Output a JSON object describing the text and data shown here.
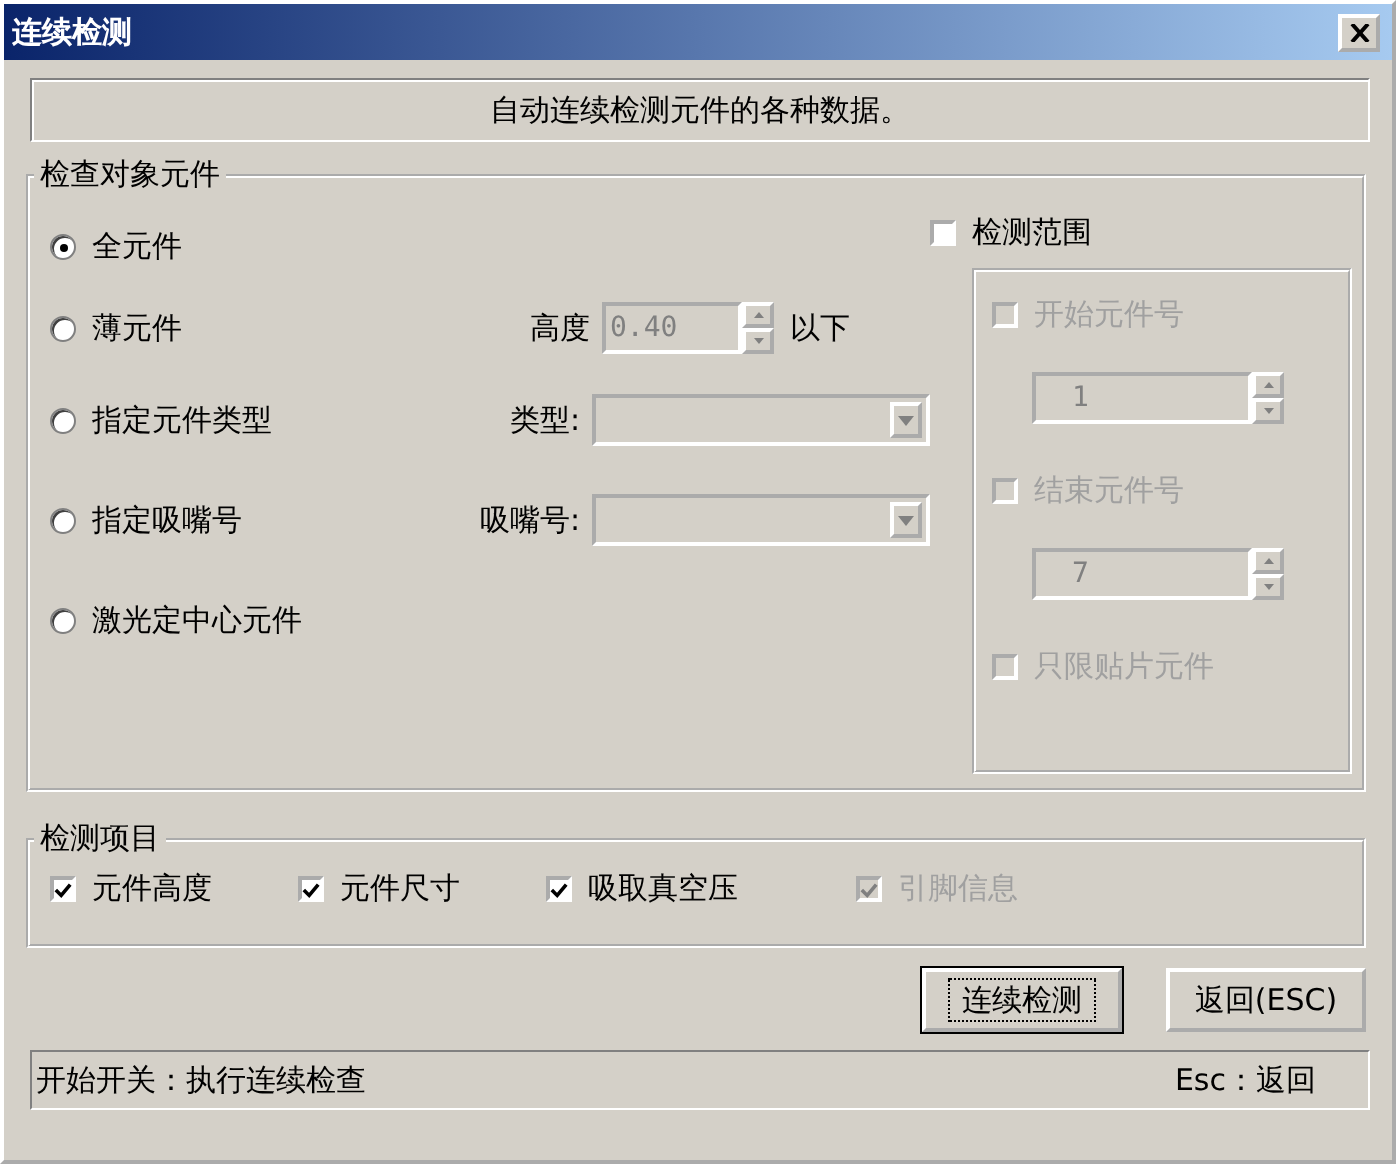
{
  "window": {
    "title": "连续检测"
  },
  "description": "自动连续检测元件的各种数据。",
  "target_group": {
    "title": "检查对象元件",
    "options": [
      {
        "label": "全元件",
        "selected": true
      },
      {
        "label": "薄元件",
        "selected": false,
        "control": {
          "kind": "spin",
          "label": "高度",
          "value": "0.40",
          "suffix": "以下",
          "disabled": true
        }
      },
      {
        "label": "指定元件类型",
        "selected": false,
        "control": {
          "kind": "combo",
          "label": "类型:",
          "disabled": true
        }
      },
      {
        "label": "指定吸嘴号",
        "selected": false,
        "control": {
          "kind": "combo",
          "label": "吸嘴号:",
          "disabled": true
        }
      },
      {
        "label": "激光定中心元件",
        "selected": false
      }
    ],
    "range": {
      "label": "检测范围",
      "checked": false,
      "items": [
        {
          "kind": "check",
          "label": "开始元件号",
          "checked": false,
          "disabled": true
        },
        {
          "kind": "spin",
          "value": "1",
          "disabled": true
        },
        {
          "kind": "check",
          "label": "结束元件号",
          "checked": false,
          "disabled": true
        },
        {
          "kind": "spin",
          "value": "7",
          "disabled": true
        },
        {
          "kind": "check",
          "label": "只限贴片元件",
          "checked": false,
          "disabled": true
        }
      ]
    }
  },
  "items_group": {
    "title": "检测项目",
    "checks": [
      {
        "label": "元件高度",
        "checked": true,
        "disabled": false
      },
      {
        "label": "元件尺寸",
        "checked": true,
        "disabled": false
      },
      {
        "label": "吸取真空压",
        "checked": true,
        "disabled": false
      },
      {
        "label": "引脚信息",
        "checked": true,
        "disabled": true
      }
    ]
  },
  "buttons": [
    {
      "label": "连续检测",
      "default": true
    },
    {
      "label": "返回(ESC)",
      "default": false
    }
  ],
  "status_bar": {
    "left": "开始开关：执行连续检查",
    "right": "Esc：返回"
  }
}
